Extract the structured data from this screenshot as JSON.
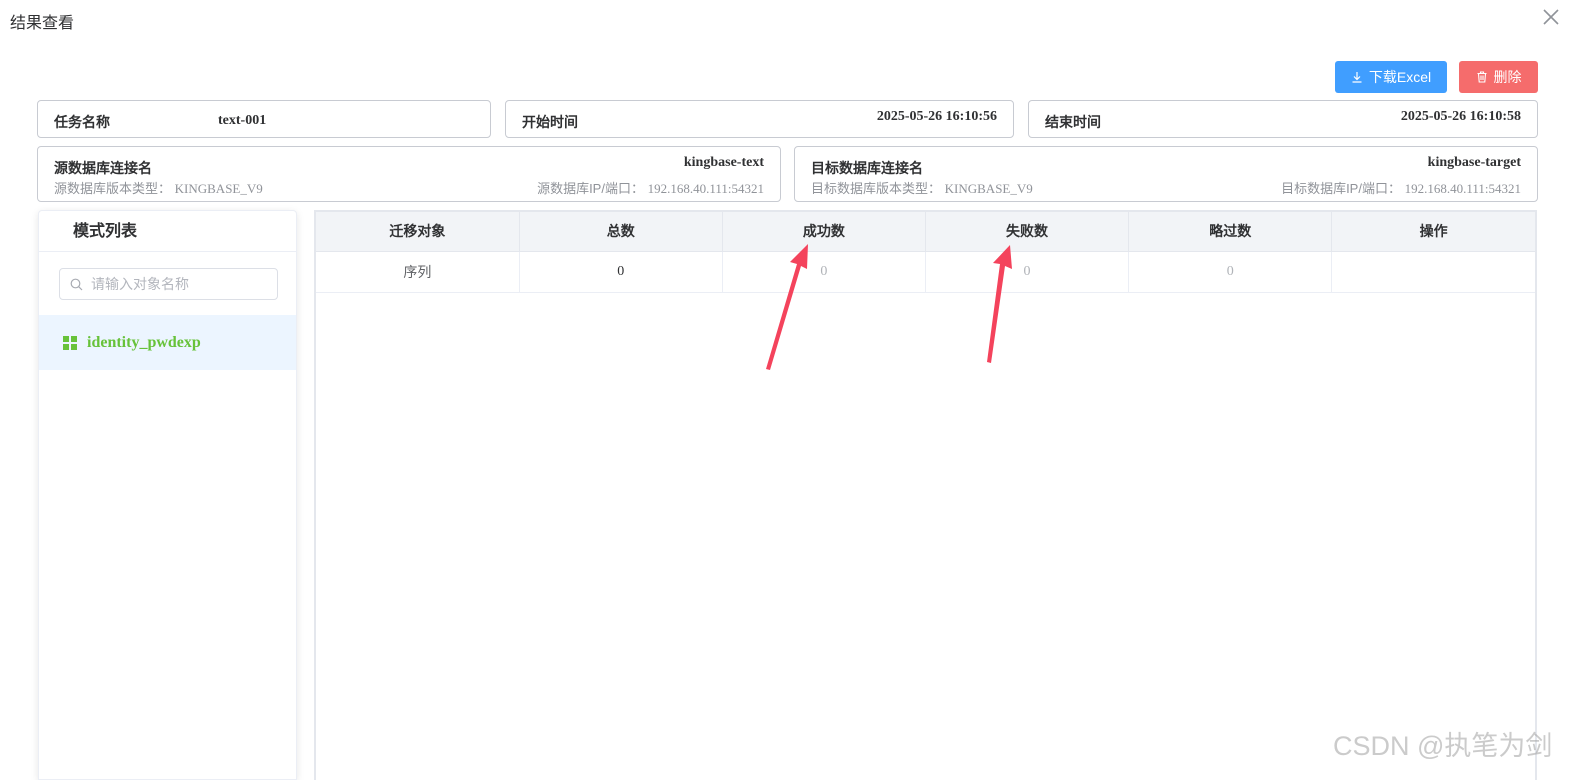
{
  "dialog": {
    "title": "结果查看"
  },
  "toolbar": {
    "download_label": "下载Excel",
    "delete_label": "删除"
  },
  "info": {
    "task_name_label": "任务名称",
    "task_name_value": "text-001",
    "start_time_label": "开始时间",
    "start_time_value": "2025-05-26 16:10:56",
    "end_time_label": "结束时间",
    "end_time_value": "2025-05-26 16:10:58",
    "source": {
      "label": "源数据库连接名",
      "value": "kingbase-text",
      "version_label": "源数据库版本类型：",
      "version_value": "KINGBASE_V9",
      "ip_label": "源数据库IP/端口：",
      "ip_value": "192.168.40.111:54321"
    },
    "target": {
      "label": "目标数据库连接名",
      "value": "kingbase-target",
      "version_label": "目标数据库版本类型：",
      "version_value": "KINGBASE_V9",
      "ip_label": "目标数据库IP/端口：",
      "ip_value": "192.168.40.111:54321"
    }
  },
  "schema_panel": {
    "title": "模式列表",
    "search_placeholder": "请输入对象名称",
    "items": [
      {
        "label": "identity_pwdexp",
        "selected": true
      }
    ]
  },
  "table": {
    "headers": [
      "迁移对象",
      "总数",
      "成功数",
      "失败数",
      "略过数",
      "操作"
    ],
    "rows": [
      {
        "object": "序列",
        "total": "0",
        "success": "0",
        "failed": "0",
        "skipped": "0",
        "action": ""
      }
    ]
  },
  "colors": {
    "primary": "#409eff",
    "danger": "#f56c6c",
    "success_text": "#67c23a",
    "annotation_arrow": "#f4435c"
  },
  "watermark": "CSDN @执笔为剑"
}
